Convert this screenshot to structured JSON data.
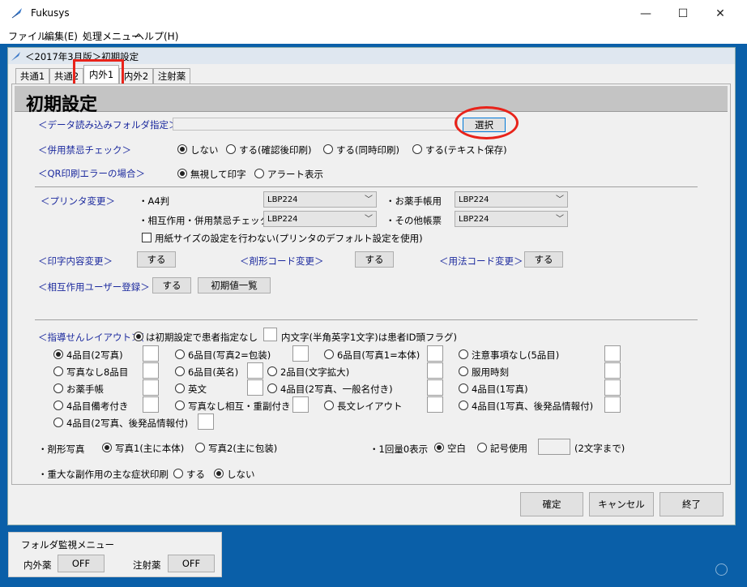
{
  "window": {
    "title": "Fukusys",
    "min": "—",
    "max": "☐",
    "close": "✕"
  },
  "menu": [
    "ファイル",
    "編集(E)",
    "処理メニュー",
    "ヘルプ(H)"
  ],
  "child": {
    "title": "＜2017年3月版＞初期設定"
  },
  "tabs": [
    "共通1",
    "共通2",
    "内外1",
    "内外2",
    "注射薬"
  ],
  "header": "初期設定",
  "folder": {
    "label": "＜データ読み込みフォルダ指定＞",
    "value": "",
    "button": "選択"
  },
  "combo_check": {
    "label": "＜併用禁忌チェック＞",
    "options": [
      "しない",
      "する(確認後印刷)",
      "する(同時印刷)",
      "する(テキスト保存)"
    ]
  },
  "qr": {
    "label": "＜QR印刷エラーの場合＞",
    "options": [
      "無視して印字",
      "アラート表示"
    ]
  },
  "printer": {
    "label": "＜プリンタ変更＞",
    "a4_label": "・A4判",
    "a4_value": "LBP224",
    "notebook_label": "・お薬手帳用",
    "notebook_value": "LBP224",
    "interact_label": "・相互作用・併用禁忌チェック",
    "interact_value": "LBP224",
    "other_label": "・その他帳票",
    "other_value": "LBP224",
    "paper_check": "用紙サイズの設定を行わない(プリンタのデフォルト設定を使用)"
  },
  "print_change": {
    "label": "＜印字内容変更＞",
    "button": "する"
  },
  "form_code": {
    "label": "＜剤形コード変更＞",
    "button": "する"
  },
  "usage_code": {
    "label": "＜用法コード変更＞",
    "button": "する"
  },
  "interact_user": {
    "label": "＜相互作用ユーザー登録＞",
    "button": "する",
    "list_button": "初期値一覧"
  },
  "layout": {
    "label_prefix": "＜指導せんレイアウト＞(",
    "label_mid": "は初期設定で患者指定なし",
    "label_suffix": "内文字(半角英字1文字)は患者ID頭フラグ)",
    "options": [
      "4品目(2写真)",
      "6品目(写真2=包装)",
      "6品目(写真1=本体)",
      "注意事項なし(5品目)",
      "写真なし8品目",
      "6品目(英名)",
      "2品目(文字拡大)",
      "服用時刻",
      "お薬手帳",
      "英文",
      "4品目(2写真、一般名付き)",
      "4品目(1写真)",
      "4品目備考付き",
      "写真なし相互・重副付き",
      "長文レイアウト",
      "4品目(1写真、後発品情報付)",
      "4品目(2写真、後発品情報付)"
    ]
  },
  "form_photo": {
    "label": "・剤形写真",
    "options": [
      "写真1(主に本体)",
      "写真2(主に包装)"
    ]
  },
  "dose_zero": {
    "label": "・1回量0表示",
    "options": [
      "空白",
      "記号使用"
    ],
    "note": "(2文字まで)"
  },
  "side_effect": {
    "label": "・重大な副作用の主な症状印刷",
    "options": [
      "する",
      "しない"
    ]
  },
  "footer": {
    "ok": "確定",
    "cancel": "キャンセル",
    "exit": "終了"
  },
  "monitor": {
    "legend": "フォルダ監視メニュー",
    "internal_label": "内外薬",
    "internal_btn": "OFF",
    "inject_label": "注射薬",
    "inject_btn": "OFF"
  },
  "colors": {
    "accent_blue": "#1c2a9e",
    "mdi_blue": "#0a5fa8",
    "highlight_red": "#e8231a"
  }
}
